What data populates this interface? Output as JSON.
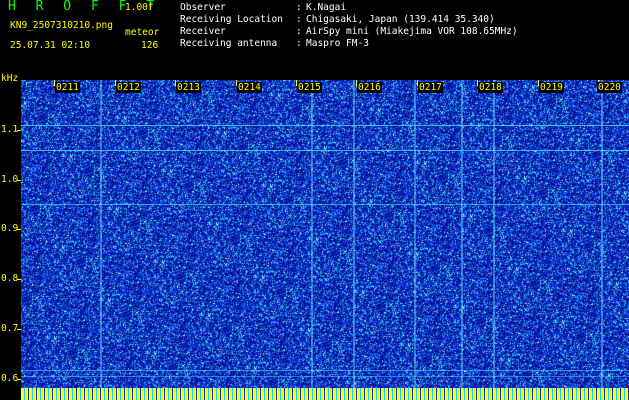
{
  "header": {
    "app_title": "H R O F F T",
    "version": "1.00f",
    "filename": "KN9_2507310210.png",
    "mode": "meteor",
    "datetime": "25.07.31 02:10",
    "count": "126"
  },
  "info": [
    {
      "label": "Observer",
      "value": "K.Nagai"
    },
    {
      "label": "Receiving Location",
      "value": "Chigasaki, Japan (139.414 35.340)"
    },
    {
      "label": "Receiver",
      "value": "AirSpy mini (Miakejima VOR 108.65MHz)"
    },
    {
      "label": "Receiving antenna",
      "value": "Maspro FM-3"
    }
  ],
  "axis": {
    "unit": "kHz",
    "y_labels": [
      "1.1",
      "1.0",
      "0.9",
      "0.8",
      "0.7",
      "0.6"
    ]
  },
  "timeline": {
    "labels": [
      "0211",
      "0212",
      "0213",
      "0214",
      "0215",
      "0216",
      "0217",
      "0218",
      "0219",
      "0220"
    ]
  },
  "colors": {
    "background": "#000000",
    "label_yellow": "#ffff00",
    "title_green": "#00ff00",
    "spectrum_blue": "#1226a6",
    "signal_cyan": "#47e6ff"
  }
}
